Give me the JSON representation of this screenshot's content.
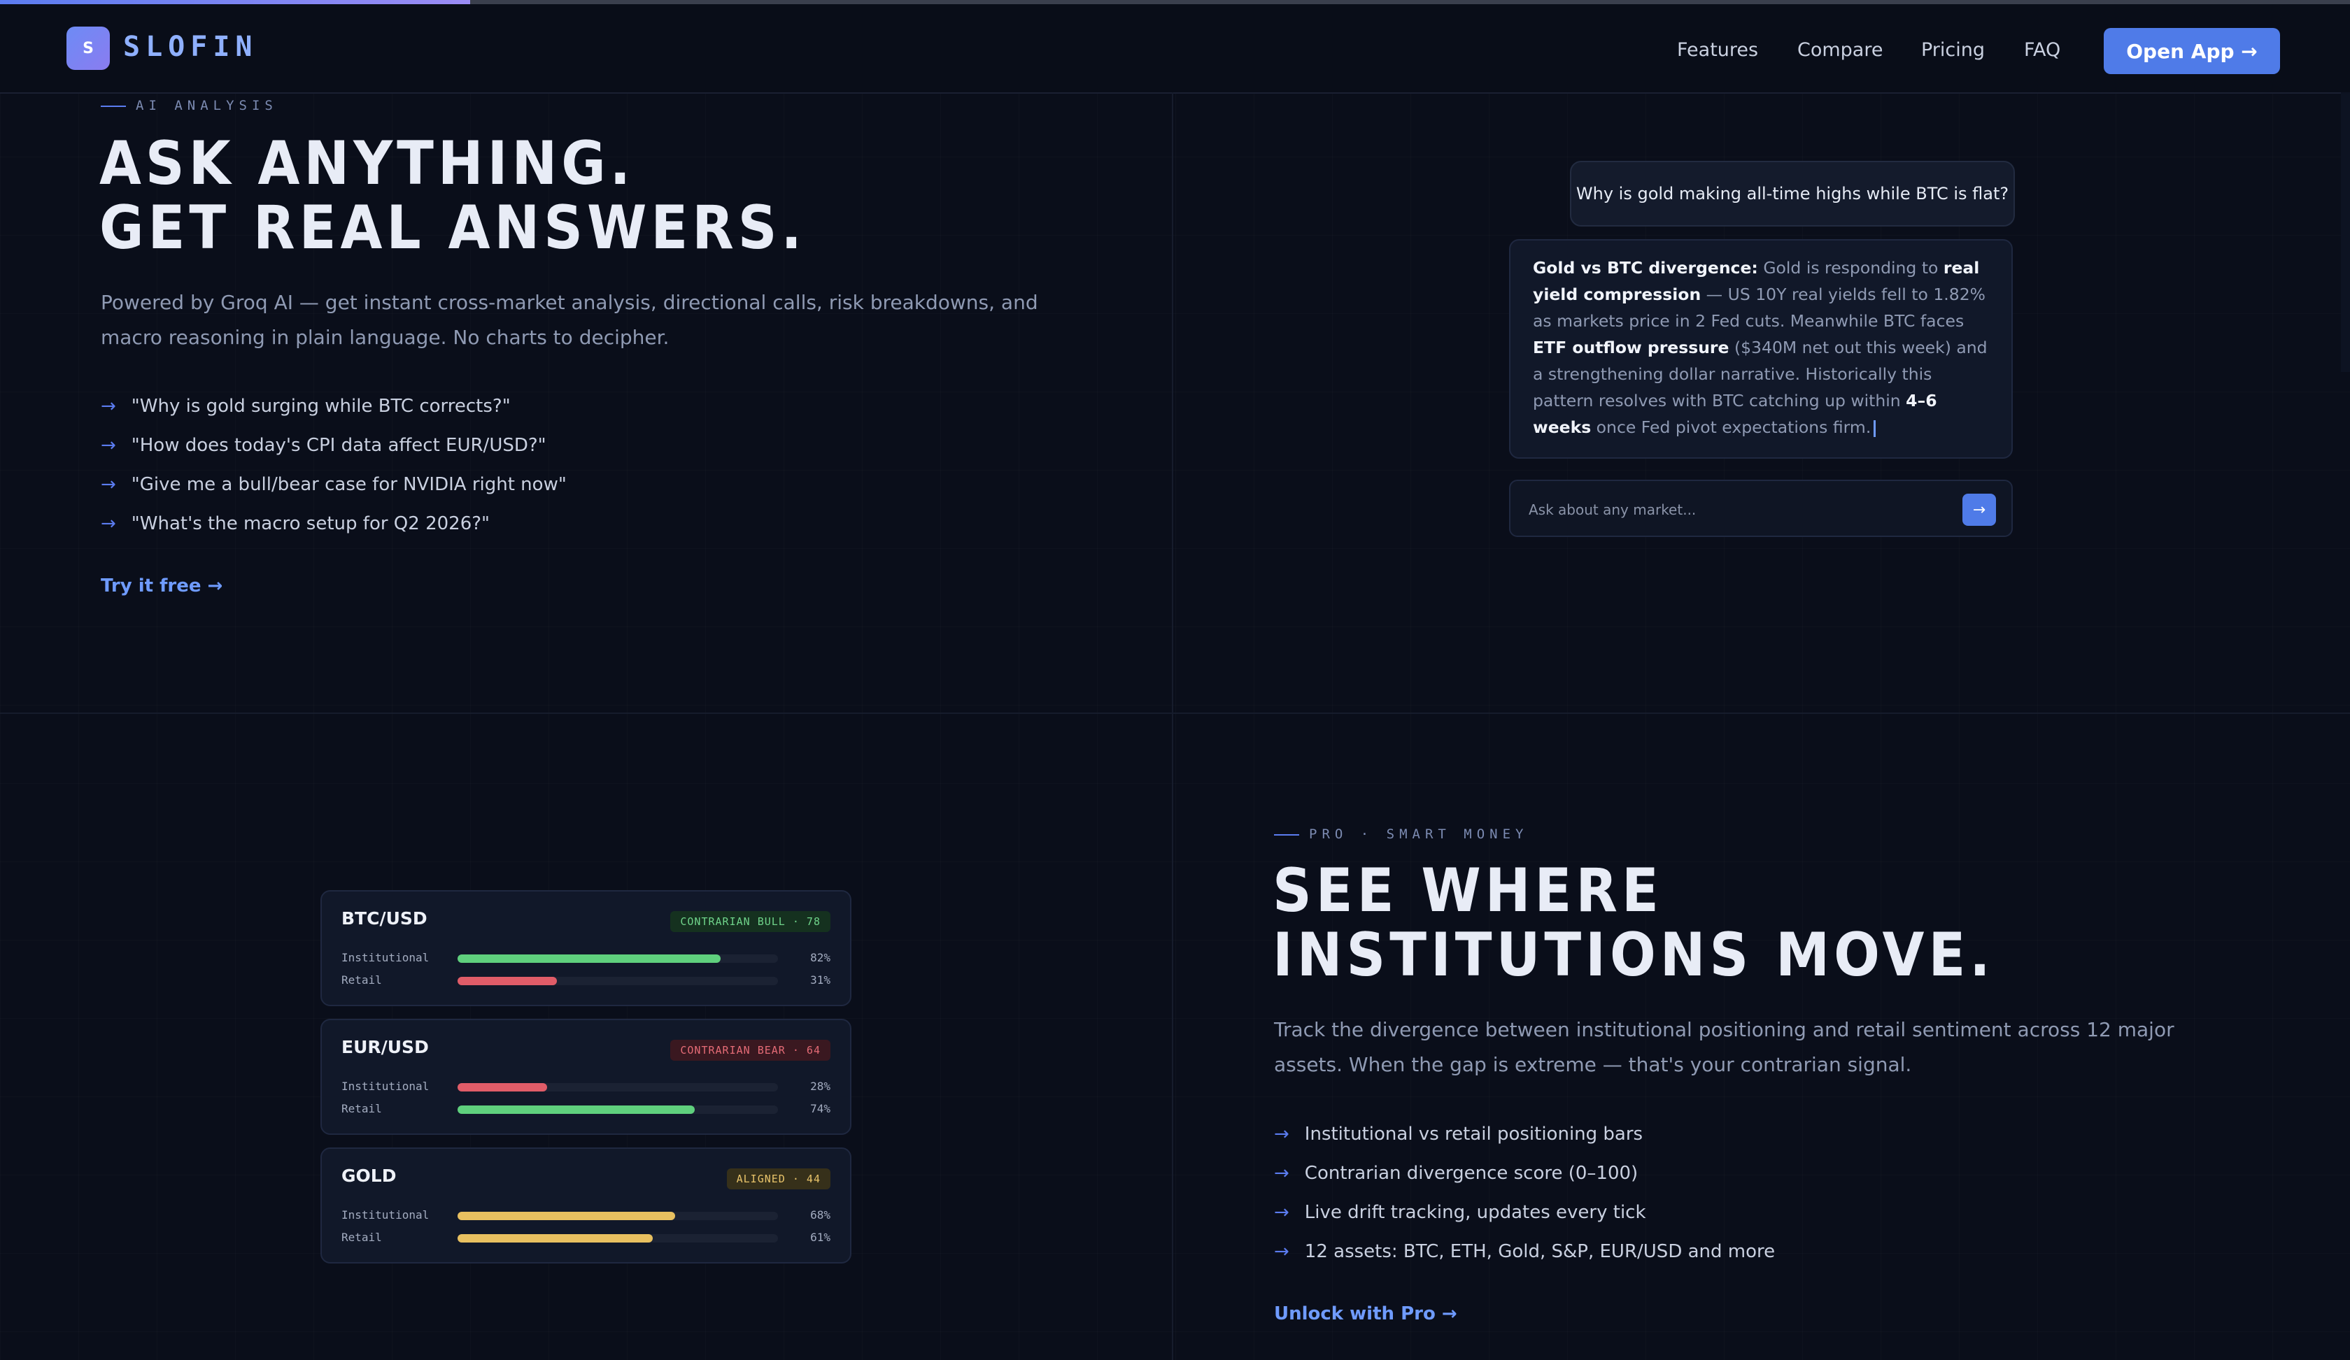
{
  "progress": {
    "fraction": 0.2
  },
  "nav": {
    "logo_letter": "S",
    "logo_text": "SLOFIN",
    "links": [
      "Features",
      "Compare",
      "Pricing",
      "FAQ"
    ],
    "open_app": "Open App →"
  },
  "ai_section": {
    "eyebrow": "AI ANALYSIS",
    "headline_1": "ASK ANYTHING.",
    "headline_2": "GET REAL ANSWERS.",
    "sub": "Powered by Groq AI — get instant cross-market analysis, directional calls, risk breakdowns, and macro reasoning in plain language. No charts to decipher.",
    "bullets": [
      "\"Why is gold surging while BTC corrects?\"",
      "\"How does today's CPI data affect EUR/USD?\"",
      "\"Give me a bull/bear case for NVIDIA right now\"",
      "\"What's the macro setup for Q2 2026?\""
    ],
    "cta": "Try it free →"
  },
  "chat": {
    "user_message": "Why is gold making all-time highs while BTC is flat?",
    "ai_response": {
      "p1_bold": "Gold vs BTC divergence:",
      "p1": " Gold is responding to ",
      "p2_bold": "real yield compression",
      "p2": " — US 10Y real yields fell to 1.82% as markets price in 2 Fed cuts. Meanwhile BTC faces ",
      "p3_bold": "ETF outflow pressure",
      "p3": " ($340M net out this week) and a strengthening dollar narrative. Historically this pattern resolves with BTC catching up within ",
      "p4_bold": "4–6 weeks",
      "p4": " once Fed pivot expectations firm."
    },
    "input_placeholder": "Ask about any market...",
    "send_icon": "→"
  },
  "pro_section": {
    "eyebrow": "PRO · SMART MONEY",
    "headline_1": "SEE WHERE",
    "headline_2": "INSTITUTIONS MOVE.",
    "sub": "Track the divergence between institutional positioning and retail sentiment across 12 major assets. When the gap is extreme — that's your contrarian signal.",
    "bullets": [
      "Institutional vs retail positioning bars",
      "Contrarian divergence score (0–100)",
      "Live drift tracking, updates every tick",
      "12 assets: BTC, ETH, Gold, S&P, EUR/USD and more"
    ],
    "cta": "Unlock with Pro →"
  },
  "assets": [
    {
      "name": "BTC/USD",
      "badge": "CONTRARIAN BULL · 78",
      "badge_type": "bull",
      "rows": [
        {
          "label": "Institutional",
          "value": 82,
          "pct": "82%",
          "color": "#5fd07d"
        },
        {
          "label": "Retail",
          "value": 31,
          "pct": "31%",
          "color": "#e05c68"
        }
      ]
    },
    {
      "name": "EUR/USD",
      "badge": "CONTRARIAN BEAR · 64",
      "badge_type": "bear",
      "rows": [
        {
          "label": "Institutional",
          "value": 28,
          "pct": "28%",
          "color": "#e05c68"
        },
        {
          "label": "Retail",
          "value": 74,
          "pct": "74%",
          "color": "#5fd07d"
        }
      ]
    },
    {
      "name": "GOLD",
      "badge": "ALIGNED · 44",
      "badge_type": "aligned",
      "rows": [
        {
          "label": "Institutional",
          "value": 68,
          "pct": "68%",
          "color": "#e8c060"
        },
        {
          "label": "Retail",
          "value": 61,
          "pct": "61%",
          "color": "#e8c060"
        }
      ]
    }
  ]
}
